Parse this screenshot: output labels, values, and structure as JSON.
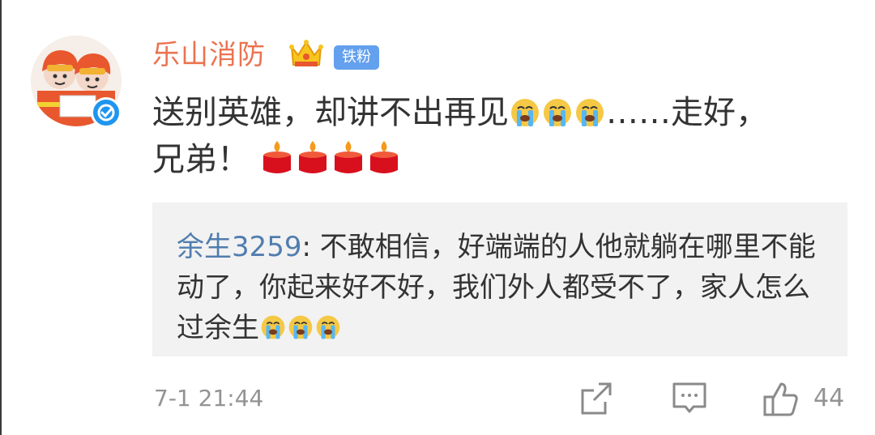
{
  "post": {
    "author": "乐山消防",
    "badge": "铁粉",
    "text_parts": [
      "送别英雄，却讲不出再见",
      "……走好，",
      "兄弟！"
    ],
    "emoji": {
      "cry": "cry-face-icon",
      "candle": "candle-icon"
    }
  },
  "reply": {
    "user": "余生3259",
    "separator": ": ",
    "text": "不敢相信，好端端的人他就躺在哪里不能动了，你起来好不好，我们外人都受不了，家人怎么过余生"
  },
  "footer": {
    "time": "7-1 21:44",
    "like_count": "44"
  },
  "colors": {
    "author": "#eb7350",
    "badge_bg": "#63a0ee",
    "link": "#507daf",
    "quote_bg": "#f2f2f2",
    "muted": "#939393",
    "verified": "#1f95f0"
  }
}
